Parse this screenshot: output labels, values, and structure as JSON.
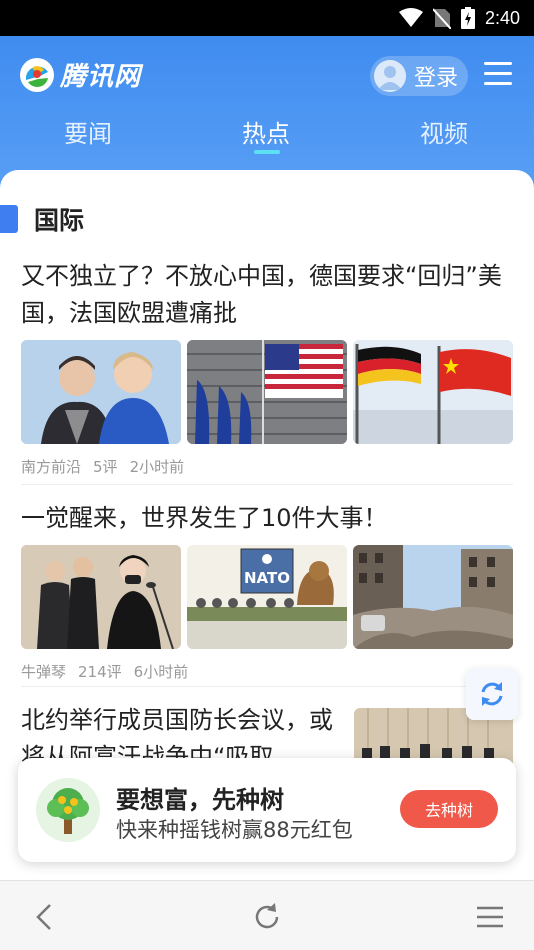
{
  "status_bar": {
    "time": "2:40"
  },
  "header": {
    "logo_text": "腾讯网",
    "login_label": "登录",
    "tabs": [
      {
        "label": "要闻",
        "active": false
      },
      {
        "label": "热点",
        "active": true
      },
      {
        "label": "视频",
        "active": false
      }
    ]
  },
  "section": {
    "title": "国际"
  },
  "news": [
    {
      "title": "又不独立了？不放心中国，德国要求“回归”美国，法国欧盟遭痛批",
      "source": "南方前沿",
      "comments": "5评",
      "time": "2小时前"
    },
    {
      "title": "一觉醒来，世界发生了10件大事！",
      "source": "牛弹琴",
      "comments": "214评",
      "time": "6小时前",
      "image_text": "NATO"
    },
    {
      "title": "北约举行成员国防长会议，或将从阿富汗战争中“吸取"
    }
  ],
  "ad": {
    "title": "要想富，先种树",
    "subtitle": "快来种摇钱树赢88元红包",
    "button": "去种树"
  },
  "colors": {
    "brand": "#3f8cf0",
    "accent": "#f0584a",
    "indicator": "#5ee0f4"
  }
}
